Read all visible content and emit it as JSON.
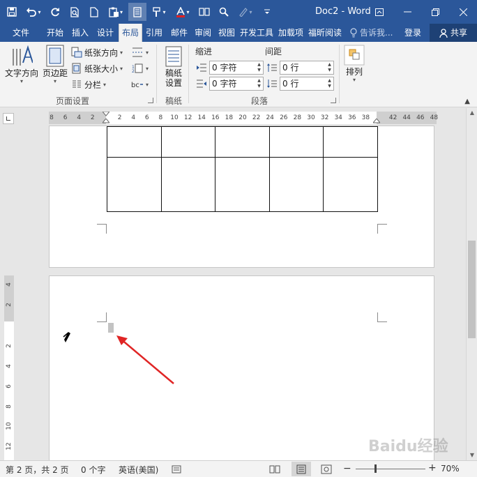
{
  "window": {
    "title": "Doc2 - Word"
  },
  "tabs": [
    {
      "label": "文件"
    },
    {
      "label": "开始"
    },
    {
      "label": "插入"
    },
    {
      "label": "设计"
    },
    {
      "label": "布局"
    },
    {
      "label": "引用"
    },
    {
      "label": "邮件"
    },
    {
      "label": "审阅"
    },
    {
      "label": "视图"
    },
    {
      "label": "开发工具"
    },
    {
      "label": "加载项"
    },
    {
      "label": "福昕阅读"
    }
  ],
  "tell_me": "告诉我...",
  "sign_in": "登录",
  "share": "共享",
  "ribbon": {
    "page_setup": {
      "text_direction": "文字方向",
      "margins": "页边距",
      "orientation": "纸张方向",
      "size": "纸张大小",
      "columns": "分栏",
      "group_label": "页面设置"
    },
    "draft": {
      "button": "稿纸设置",
      "button_line1": "稿纸",
      "button_line2": "设置",
      "group_label": "稿纸"
    },
    "paragraph": {
      "indent_header": "缩进",
      "spacing_header": "间距",
      "indent_left": "0 字符",
      "indent_right": "0 字符",
      "spacing_before": "0 行",
      "spacing_after": "0 行",
      "group_label": "段落"
    },
    "arrange": {
      "label": "排列"
    }
  },
  "ruler": {
    "left_ticks": [
      "8",
      "6",
      "4",
      "2"
    ],
    "right_ticks": [
      "2",
      "4",
      "6",
      "8",
      "10",
      "12",
      "14",
      "16",
      "18",
      "20",
      "22",
      "24",
      "26",
      "28",
      "30",
      "32",
      "34",
      "36",
      "38"
    ],
    "margin_ticks": [
      "42",
      "44",
      "46",
      "48"
    ],
    "vertical_ticks": [
      "4",
      "2",
      "2",
      "4",
      "6",
      "8",
      "10",
      "12"
    ]
  },
  "status": {
    "page": "第 2 页，共 2 页",
    "words": "0 个字",
    "language": "英语(美国)",
    "zoom": "70%",
    "zoom_level_percent": 70
  },
  "watermark": "Baidu经验"
}
